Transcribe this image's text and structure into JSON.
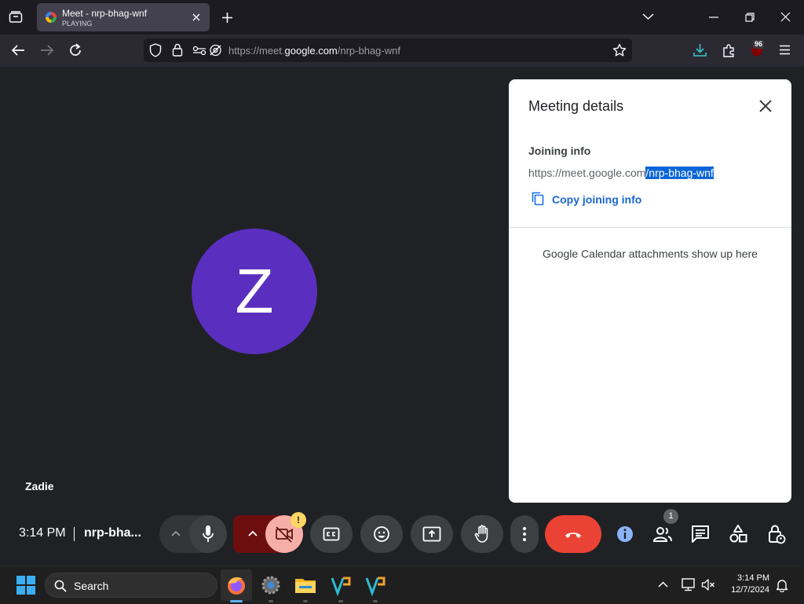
{
  "browser": {
    "tab_title": "Meet - nrp-bhag-wnf",
    "tab_status": "PLAYING",
    "url_prefix": "https://meet.",
    "url_domain": "google.com",
    "url_path": "/nrp-bhag-wnf",
    "extension_badge": "96"
  },
  "meeting": {
    "avatar_initial": "Z",
    "participant_name": "Zadie",
    "time": "3:14 PM",
    "meeting_code": "nrp-bha...",
    "participants_count": "1",
    "warning_mark": "!"
  },
  "panel": {
    "title": "Meeting details",
    "joining_heading": "Joining info",
    "url_base": "https://meet.google.com",
    "url_selected": "/nrp-bhag-wnf",
    "copy_label": "Copy joining info",
    "calendar_text": "Google Calendar attachments show up here"
  },
  "taskbar": {
    "search_placeholder": "Search",
    "clock_time": "3:14 PM",
    "clock_date": "12/7/2024"
  },
  "colors": {
    "avatar": "#5a2fbf",
    "hangup": "#ea4335",
    "accent": "#1a73e8",
    "camera_off": "#f6aea9"
  }
}
